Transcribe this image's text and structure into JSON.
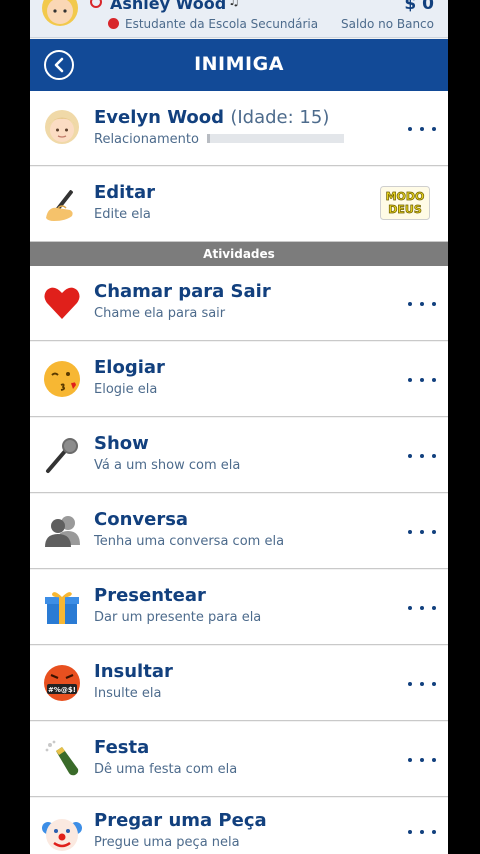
{
  "topbar": {
    "name": "Ashley Wood",
    "note_glyph": "♫",
    "subtitle": "Estudante da Escola Secundária",
    "money": "$ 0",
    "bank_label": "Saldo no Banco"
  },
  "header": {
    "title": "INIMIGA"
  },
  "profile": {
    "name": "Evelyn Wood",
    "age": "(Idade: 15)",
    "relationship_label": "Relacionamento",
    "relationship_level": 0.02
  },
  "edit": {
    "title": "Editar",
    "subtitle": "Edite ela",
    "badge_line1": "MODO",
    "badge_line2": "DEUS"
  },
  "section": {
    "title": "Atividades"
  },
  "activities": [
    {
      "title": "Chamar para Sair",
      "subtitle": "Chame ela para sair",
      "icon": "heart-icon"
    },
    {
      "title": "Elogiar",
      "subtitle": "Elogie ela",
      "icon": "kiss-face-icon"
    },
    {
      "title": "Show",
      "subtitle": "Vá a um show com ela",
      "icon": "microphone-icon"
    },
    {
      "title": "Conversa",
      "subtitle": "Tenha uma conversa com ela",
      "icon": "people-icon"
    },
    {
      "title": "Presentear",
      "subtitle": "Dar um presente para ela",
      "icon": "gift-icon"
    },
    {
      "title": "Insultar",
      "subtitle": "Insulte ela",
      "icon": "cursing-face-icon",
      "icon_text": "#%@$!"
    },
    {
      "title": "Festa",
      "subtitle": "Dê uma festa com ela",
      "icon": "champagne-icon"
    },
    {
      "title": "Pregar uma Peça",
      "subtitle": "Pregue uma peça nela",
      "icon": "clown-icon"
    }
  ],
  "colors": {
    "header": "#124a97",
    "title_text": "#12407e",
    "sub_text": "#4d6b8c",
    "section": "#7c7c7c"
  }
}
